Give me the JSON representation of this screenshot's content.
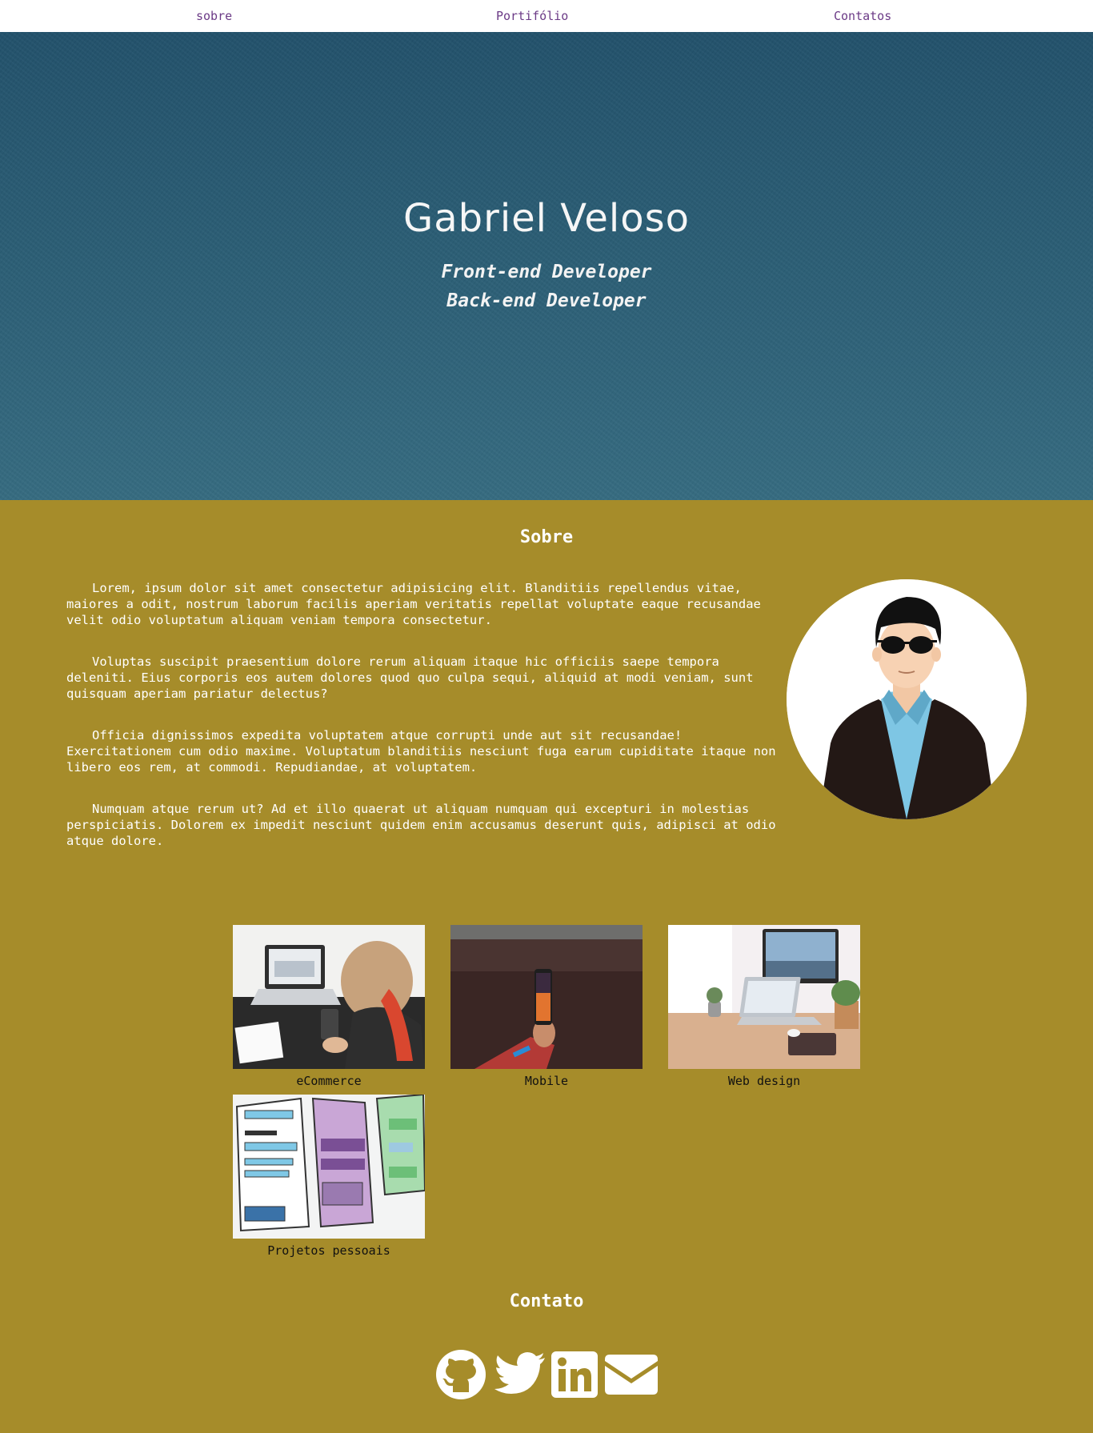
{
  "nav": {
    "items": [
      {
        "label": "sobre"
      },
      {
        "label": "Portifólio"
      },
      {
        "label": "Contatos"
      }
    ]
  },
  "hero": {
    "name": "Gabriel Veloso",
    "roles": [
      "Front-end Developer",
      "Back-end Developer"
    ]
  },
  "about": {
    "title": "Sobre",
    "paragraphs": [
      "Lorem, ipsum dolor sit amet consectetur adipisicing elit. Blanditiis repellendus vitae, maiores a odit, nostrum laborum facilis aperiam veritatis repellat voluptate eaque recusandae velit odio voluptatum aliquam veniam tempora consectetur.",
      "Voluptas suscipit praesentium dolore rerum aliquam itaque hic officiis saepe tempora deleniti. Eius corporis eos autem dolores quod quo culpa sequi, aliquid at modi veniam, sunt quisquam aperiam pariatur delectus?",
      "Officia dignissimos expedita voluptatem atque corrupti unde aut sit recusandae! Exercitationem cum odio maxime. Voluptatum blanditiis nesciunt fuga earum cupiditate itaque non libero eos rem, at commodi. Repudiandae, at voluptatem.",
      "Numquam atque rerum ut? Ad et illo quaerat ut aliquam numquam qui excepturi in molestias perspiciatis. Dolorem ex impedit nesciunt quidem enim accusamus deserunt quis, adipisci at odio atque dolore."
    ]
  },
  "portfolio": {
    "items": [
      {
        "label": "eCommerce"
      },
      {
        "label": "Mobile"
      },
      {
        "label": "Web design"
      },
      {
        "label": "Projetos pessoais"
      }
    ]
  },
  "contact": {
    "title": "Contato",
    "icons": [
      "github-icon",
      "twitter-icon",
      "linkedin-icon",
      "envelope-icon"
    ]
  },
  "colors": {
    "nav_link": "#6b3a86",
    "hero_bg": "#2b5e75",
    "page_bg": "#a68c2a",
    "text_light": "#ffffff"
  }
}
